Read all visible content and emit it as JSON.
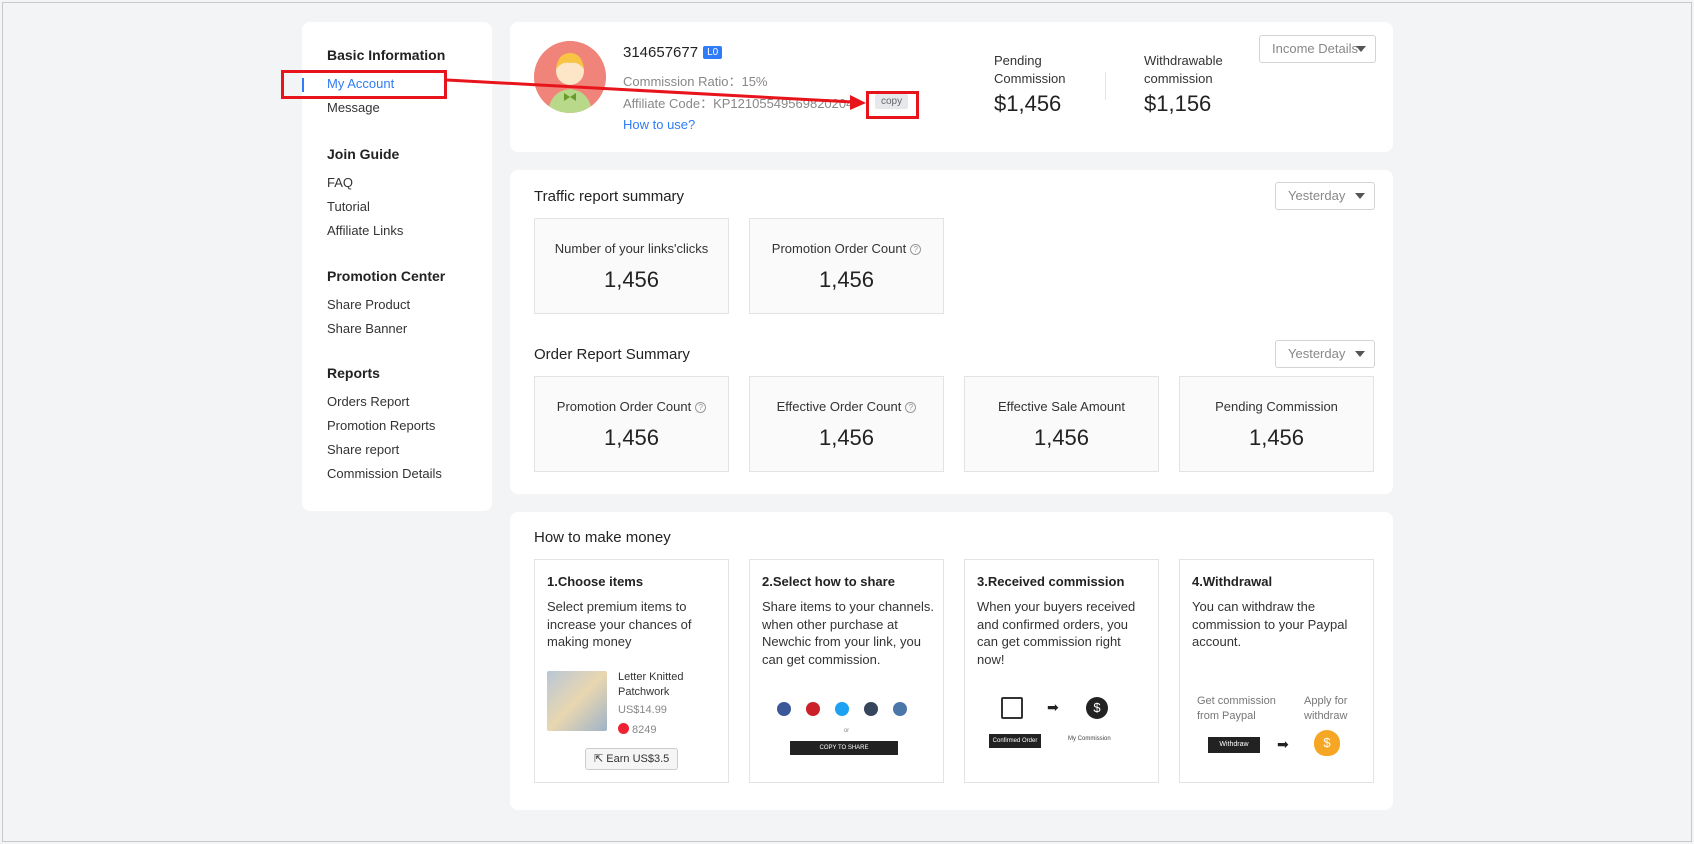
{
  "sidebar": {
    "groups": [
      {
        "title": "Basic Information",
        "items": [
          "My Account",
          "Message"
        ]
      },
      {
        "title": "Join Guide",
        "items": [
          "FAQ",
          "Tutorial",
          "Affiliate Links"
        ]
      },
      {
        "title": "Promotion Center",
        "items": [
          "Share Product",
          "Share Banner"
        ]
      },
      {
        "title": "Reports",
        "items": [
          "Orders Report",
          "Promotion Reports",
          "Share report",
          "Commission Details"
        ]
      }
    ],
    "active": "My Account"
  },
  "account": {
    "user_id": "314657677",
    "level": "L0",
    "commission_ratio": "Commission Ratio：15%",
    "affiliate_code": "Affiliate Code：KP12105549569820204",
    "copy_label": "copy",
    "how_to_use": "How to use?",
    "pending_label": "Pending Commission",
    "pending_value": "$1,456",
    "withdrawable_label": "Withdrawable commission",
    "withdrawable_value": "$1,156",
    "income_dropdown": "Income Details"
  },
  "traffic": {
    "title": "Traffic report summary",
    "period": "Yesterday",
    "cards": [
      {
        "label": "Number of your links'clicks",
        "value": "1,456",
        "help": false
      },
      {
        "label": "Promotion Order Count",
        "value": "1,456",
        "help": true
      }
    ]
  },
  "orders": {
    "title": "Order Report Summary",
    "period": "Yesterday",
    "cards": [
      {
        "label": "Promotion Order Count",
        "value": "1,456",
        "help": true
      },
      {
        "label": "Effective Order Count",
        "value": "1,456",
        "help": true
      },
      {
        "label": "Effective Sale Amount",
        "value": "1,456",
        "help": false
      },
      {
        "label": "Pending Commission",
        "value": "1,456",
        "help": false
      }
    ]
  },
  "howto": {
    "title": "How to make money",
    "steps": [
      {
        "title": "1.Choose items",
        "desc": "Select premium items to increase your chances of making money"
      },
      {
        "title": "2.Select how to share",
        "desc": "Share items to your channels. when other purchase at Newchic from your link, you can get commission."
      },
      {
        "title": "3.Received commission",
        "desc": "When your buyers received and confirmed orders, you can get commission right now!"
      },
      {
        "title": "4.Withdrawal",
        "desc": "You can withdraw the commission to your Paypal account."
      }
    ],
    "product": {
      "name": "Letter Knitted Patchwork",
      "price": "US$14.99",
      "likes": "8249",
      "earn": "Earn US$3.5"
    },
    "share": {
      "or": "or",
      "copy_to_share": "COPY TO SHARE"
    },
    "commission": {
      "confirm": "Confirmed Order",
      "my_commission": "My Commission"
    },
    "withdraw": {
      "get_label": "Get commission from Paypal",
      "apply_label": "Apply for withdraw",
      "button": "Withdraw"
    }
  },
  "colors": {
    "accent": "#2f7cf6",
    "highlight": "#e8141c"
  }
}
